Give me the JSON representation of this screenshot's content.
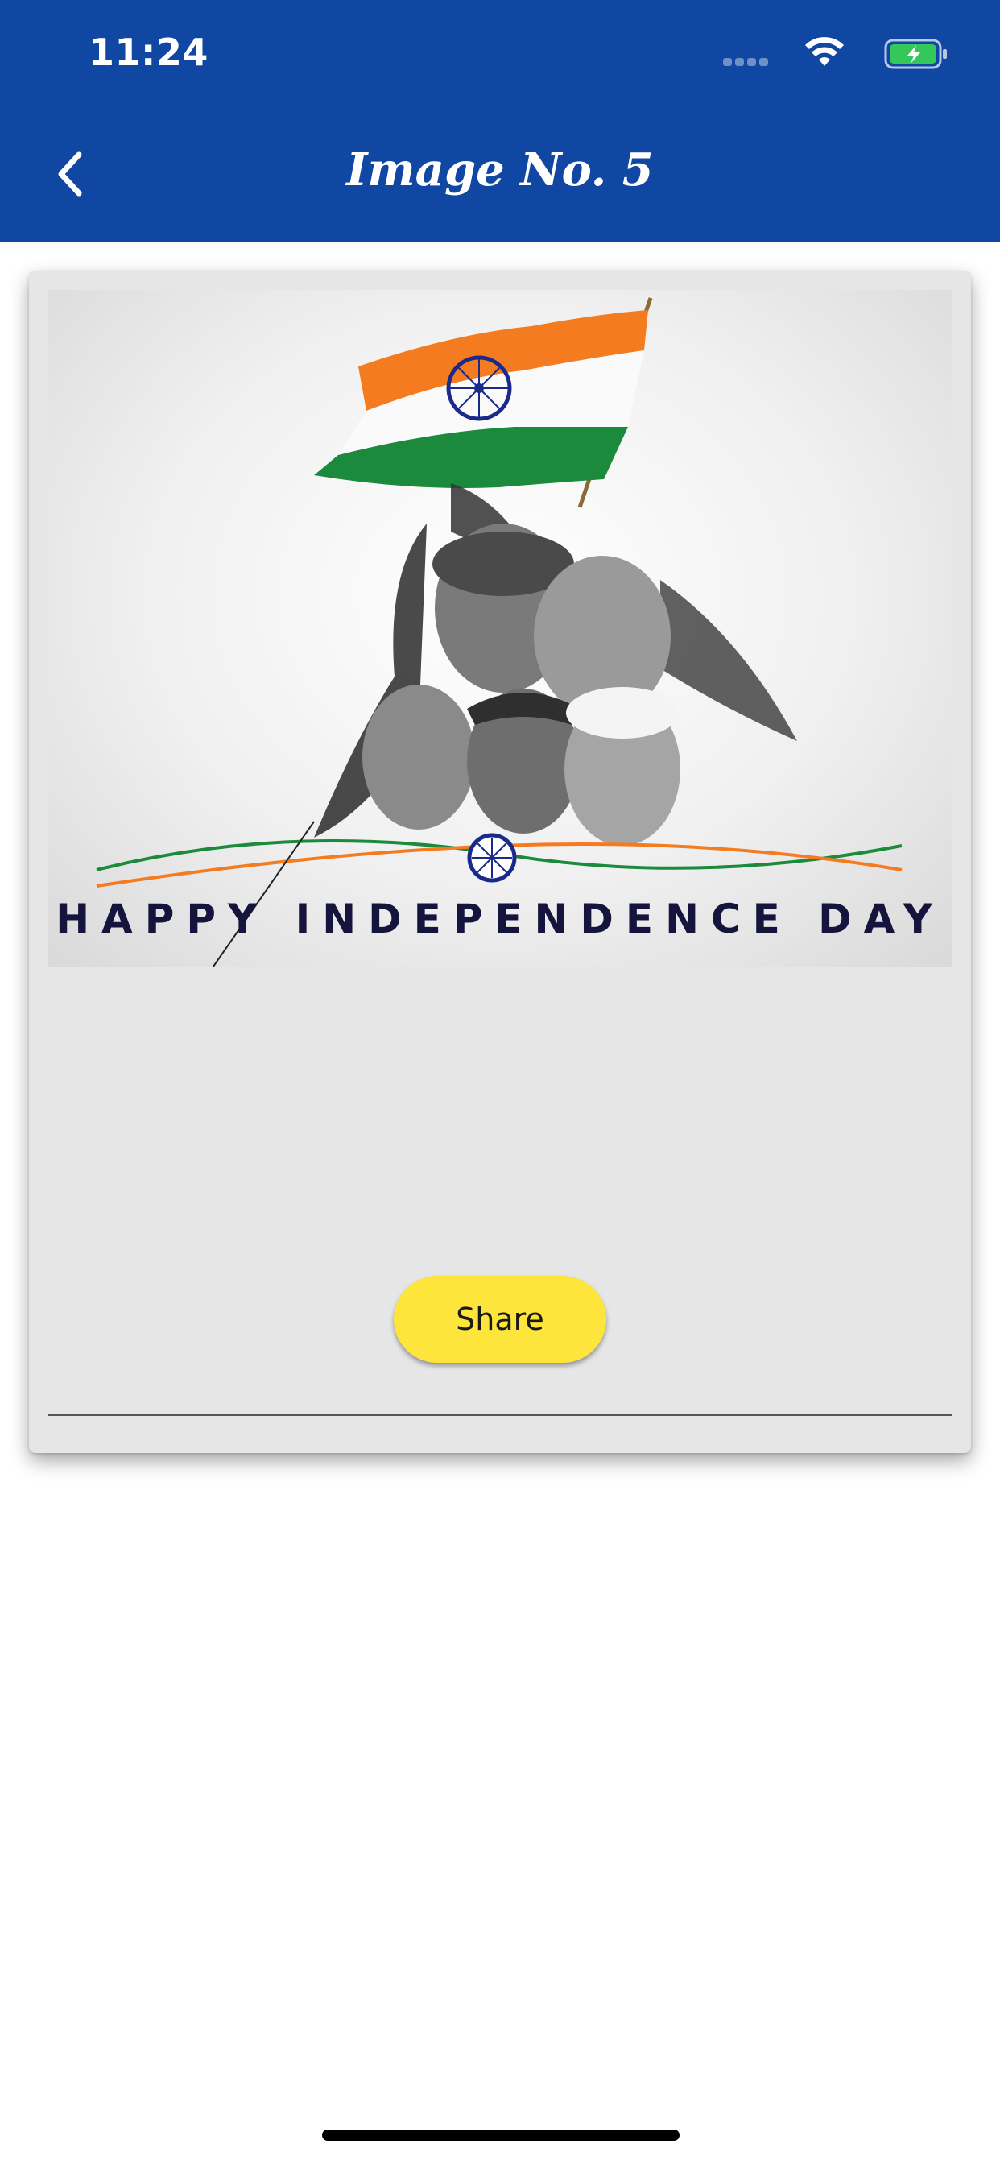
{
  "status_bar": {
    "time": "11:24",
    "icons": [
      "signal-icon",
      "wifi-icon",
      "battery-charging-icon"
    ]
  },
  "nav": {
    "title": "Image No. 5",
    "back_icon": "chevron-left-icon"
  },
  "card": {
    "image_caption": "HAPPY INDEPENDENCE DAY",
    "share_label": "Share"
  },
  "colors": {
    "header_blue": "#0f47a3",
    "share_yellow": "#fde53c",
    "card_gray": "#e6e6e6",
    "saffron": "#f47b20",
    "green": "#1c8a3c",
    "chakra_blue": "#1a2a8a",
    "battery_green": "#34c759"
  }
}
